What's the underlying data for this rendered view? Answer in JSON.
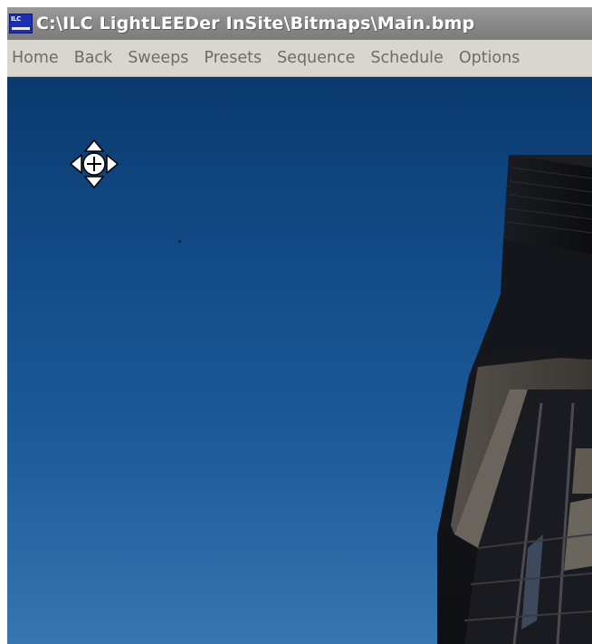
{
  "window": {
    "title": "C:\\ILC LightLEEDer InSite\\Bitmaps\\Main.bmp",
    "icon": "ilc-app-icon",
    "icon_text": "ILC"
  },
  "menubar": {
    "items": [
      {
        "label": "Home"
      },
      {
        "label": "Back"
      },
      {
        "label": "Sweeps"
      },
      {
        "label": "Presets"
      },
      {
        "label": "Sequence"
      },
      {
        "label": "Schedule"
      },
      {
        "label": "Options"
      }
    ]
  },
  "viewport": {
    "image": "building-photo-at-dusk",
    "sky_color": "#124a86",
    "pan_control_icon": "move-pan-icon"
  }
}
